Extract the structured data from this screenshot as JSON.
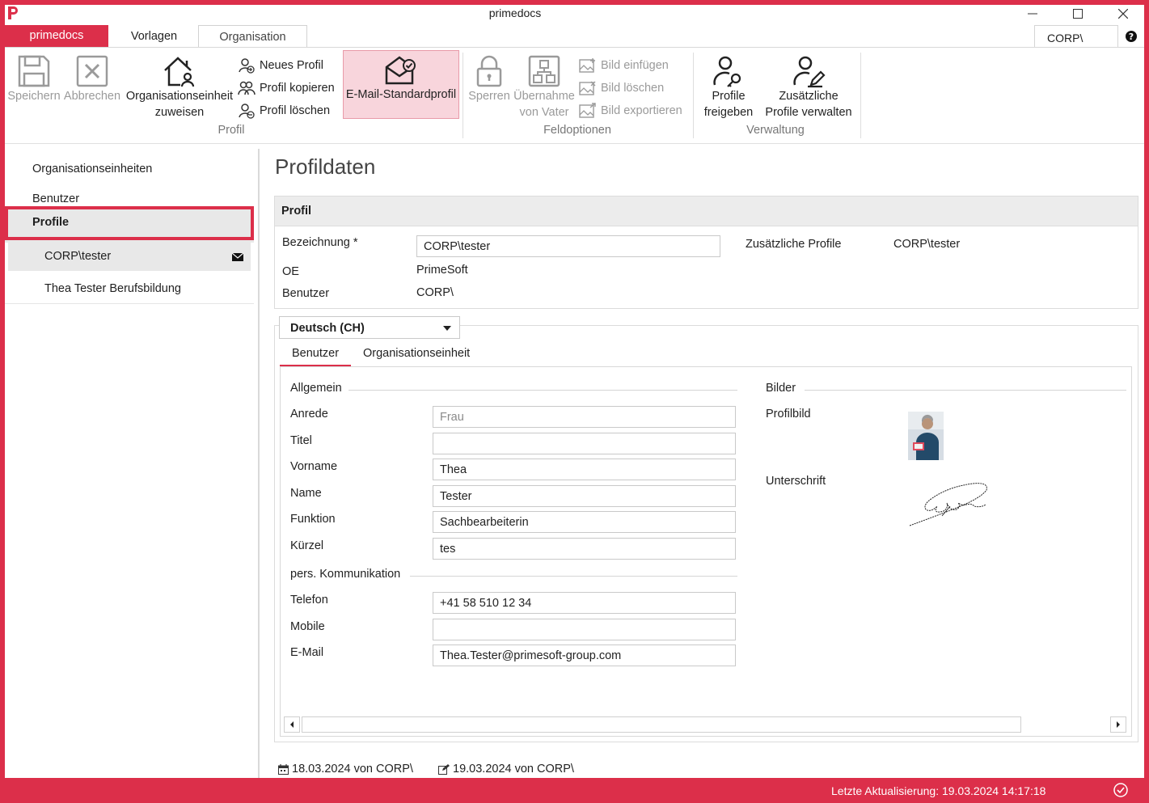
{
  "window": {
    "title": "primedocs",
    "controls": {
      "minimize": "minimize-icon",
      "maximize": "maximize-icon",
      "close": "close-icon"
    }
  },
  "tabs": {
    "app": "primedocs",
    "items": [
      "Vorlagen",
      "Organisation"
    ],
    "active": "Organisation",
    "user_box": "CORP\\"
  },
  "ribbon": {
    "profil_group": {
      "label": "Profil",
      "save": "Speichern",
      "cancel": "Abbrechen",
      "assign_oe_line1": "Organisationseinheit",
      "assign_oe_line2": "zuweisen",
      "new_profile": "Neues Profil",
      "copy_profile": "Profil kopieren",
      "delete_profile": "Profil löschen",
      "email_default": "E-Mail-Standardprofil"
    },
    "field_group": {
      "label": "Feldoptionen",
      "lock": "Sperren",
      "inherit_line1": "Übernahme",
      "inherit_line2": "von Vater",
      "insert_image": "Bild einfügen",
      "delete_image": "Bild löschen",
      "export_image": "Bild exportieren"
    },
    "admin_group": {
      "label": "Verwaltung",
      "share_line1": "Profile",
      "share_line2": "freigeben",
      "manage_line1": "Zusätzliche",
      "manage_line2": "Profile verwalten"
    }
  },
  "sidebar": {
    "items": [
      "Organisationseinheiten",
      "Benutzer",
      "Profile"
    ],
    "selected": "Profile",
    "profiles": [
      "CORP\\tester",
      "Thea Tester Berufsbildung"
    ]
  },
  "main": {
    "title": "Profildaten",
    "profile_panel": {
      "header": "Profil",
      "bezeichnung_label": "Bezeichnung *",
      "bezeichnung_value": "CORP\\tester",
      "oe_label": "OE",
      "oe_value": "PrimeSoft",
      "benutzer_label": "Benutzer",
      "benutzer_value": "CORP\\",
      "zusaetzliche_label": "Zusätzliche Profile",
      "zusaetzliche_value": "CORP\\tester"
    },
    "language": "Deutsch (CH)",
    "subtabs": [
      "Benutzer",
      "Organisationseinheit"
    ],
    "allgemein": {
      "header": "Allgemein",
      "fields": [
        {
          "label": "Anrede",
          "value": "Frau"
        },
        {
          "label": "Titel",
          "value": ""
        },
        {
          "label": "Vorname",
          "value": "Thea"
        },
        {
          "label": "Name",
          "value": "Tester"
        },
        {
          "label": "Funktion",
          "value": "Sachbearbeiterin"
        },
        {
          "label": "Kürzel",
          "value": "tes"
        }
      ]
    },
    "kommunikation": {
      "header": "pers. Kommunikation",
      "fields": [
        {
          "label": "Telefon",
          "value": "+41 58 510 12 34"
        },
        {
          "label": "Mobile",
          "value": ""
        },
        {
          "label": "E-Mail",
          "value": "Thea.Tester@primesoft-group.com"
        }
      ]
    },
    "bilder": {
      "header": "Bilder",
      "profilbild": "Profilbild",
      "unterschrift": "Unterschrift"
    },
    "created": "18.03.2024 von CORP\\",
    "modified": "19.03.2024 von CORP\\"
  },
  "status": {
    "text": "Letzte Aktualisierung: 19.03.2024 14:17:18"
  },
  "colors": {
    "accent": "#dc2f4a",
    "selected_bg": "#f8d5dc"
  }
}
